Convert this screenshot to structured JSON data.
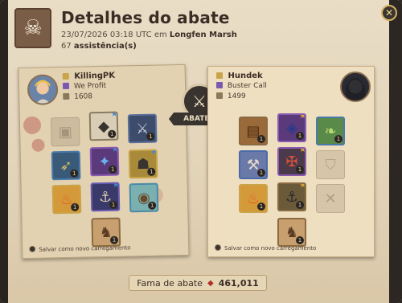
{
  "header": {
    "title": "Detalhes do abate",
    "datetime": "23/07/2026 03:18 UTC em",
    "location": "Longfen Marsh",
    "assists_count": "67",
    "assists_label": "assistência(s)"
  },
  "killer": {
    "name": "KillingPK",
    "guild": "We Profit",
    "ip": "1608",
    "save_loadout": "Salvar como novo carregamento"
  },
  "victim": {
    "name": "Hundek",
    "guild": "Buster Call",
    "ip": "1499",
    "save_loadout": "Salvar como novo carregamento"
  },
  "center": {
    "label": "ABATEU",
    "icon": "crossed-swords-icon"
  },
  "fame": {
    "label": "Fama de abate",
    "value": "461,011"
  },
  "colors": {
    "parchment": "#e4d5b7",
    "dark": "#3a3430",
    "fame_gem": "#b2302a"
  }
}
